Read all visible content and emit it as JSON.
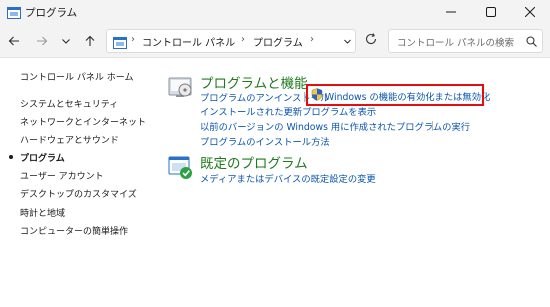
{
  "window": {
    "title": "プログラム"
  },
  "address": {
    "segments": [
      "コントロール パネル",
      "プログラム"
    ],
    "separator": "›"
  },
  "search": {
    "placeholder": "コントロール パネルの検索"
  },
  "sidebar": {
    "items": [
      {
        "label": "コントロール パネル ホーム",
        "current": false
      },
      {
        "label": "システムとセキュリティ",
        "current": false
      },
      {
        "label": "ネットワークとインターネット",
        "current": false
      },
      {
        "label": "ハードウェアとサウンド",
        "current": false
      },
      {
        "label": "プログラム",
        "current": true
      },
      {
        "label": "ユーザー アカウント",
        "current": false
      },
      {
        "label": "デスクトップのカスタマイズ",
        "current": false
      },
      {
        "label": "時計と地域",
        "current": false
      },
      {
        "label": "コンピューターの簡単操作",
        "current": false
      }
    ]
  },
  "categories": [
    {
      "title": "プログラムと機能",
      "icon": "programs-features-icon",
      "links": [
        "プログラムのアンインストール",
        "Windows の機能の有効化または無効化",
        "インストールされた更新プログラムを表示",
        "以前のバージョンの Windows 用に作成されたプログラムの実行",
        "プログラムのインストール方法"
      ]
    },
    {
      "title": "既定のプログラム",
      "icon": "default-programs-icon",
      "links": [
        "メディアまたはデバイスの既定設定の変更"
      ]
    }
  ],
  "colors": {
    "category_title": "#1e7a1e",
    "link": "#0a55b0",
    "highlight_box": "#e01010"
  }
}
